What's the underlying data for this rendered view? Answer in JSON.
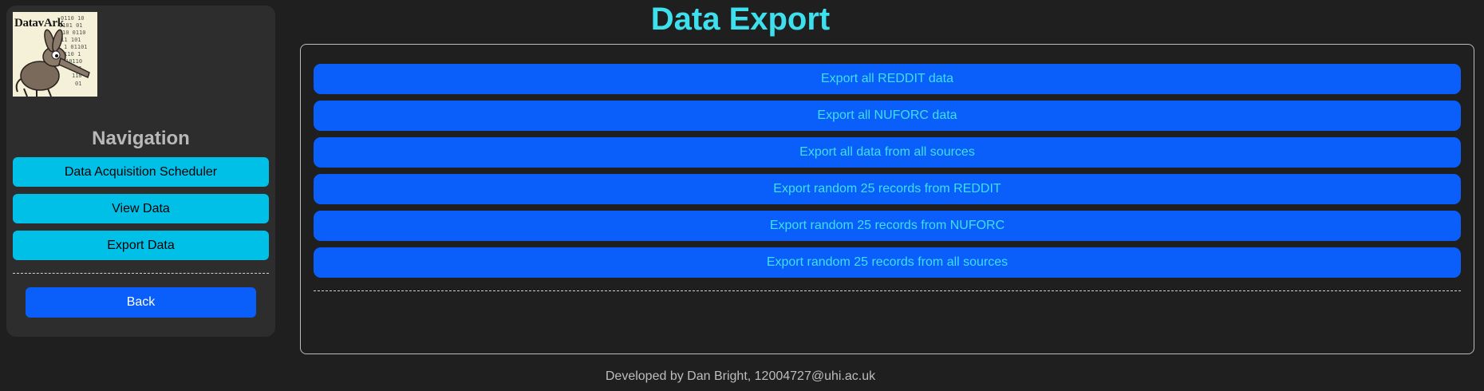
{
  "sidebar": {
    "logo_text": "DatavArk",
    "nav_heading": "Navigation",
    "nav_items": [
      {
        "label": "Data Acquisition Scheduler"
      },
      {
        "label": "View Data"
      },
      {
        "label": "Export Data"
      }
    ],
    "back_label": "Back"
  },
  "main": {
    "title": "Data Export",
    "export_buttons": [
      {
        "label": "Export all REDDIT data"
      },
      {
        "label": "Export all NUFORC data"
      },
      {
        "label": "Export all data from all sources"
      },
      {
        "label": "Export random 25 records from REDDIT"
      },
      {
        "label": "Export random 25 records from NUFORC"
      },
      {
        "label": "Export random 25 records from all sources"
      }
    ]
  },
  "footer": {
    "text": "Developed by Dan Bright, 12004727@uhi.ac.uk"
  },
  "colors": {
    "background": "#1f1f1f",
    "sidebar_bg": "#2d2d2d",
    "accent_cyan": "#3de0ec",
    "nav_button": "#00c0e8",
    "primary_blue": "#0a5ffb"
  }
}
